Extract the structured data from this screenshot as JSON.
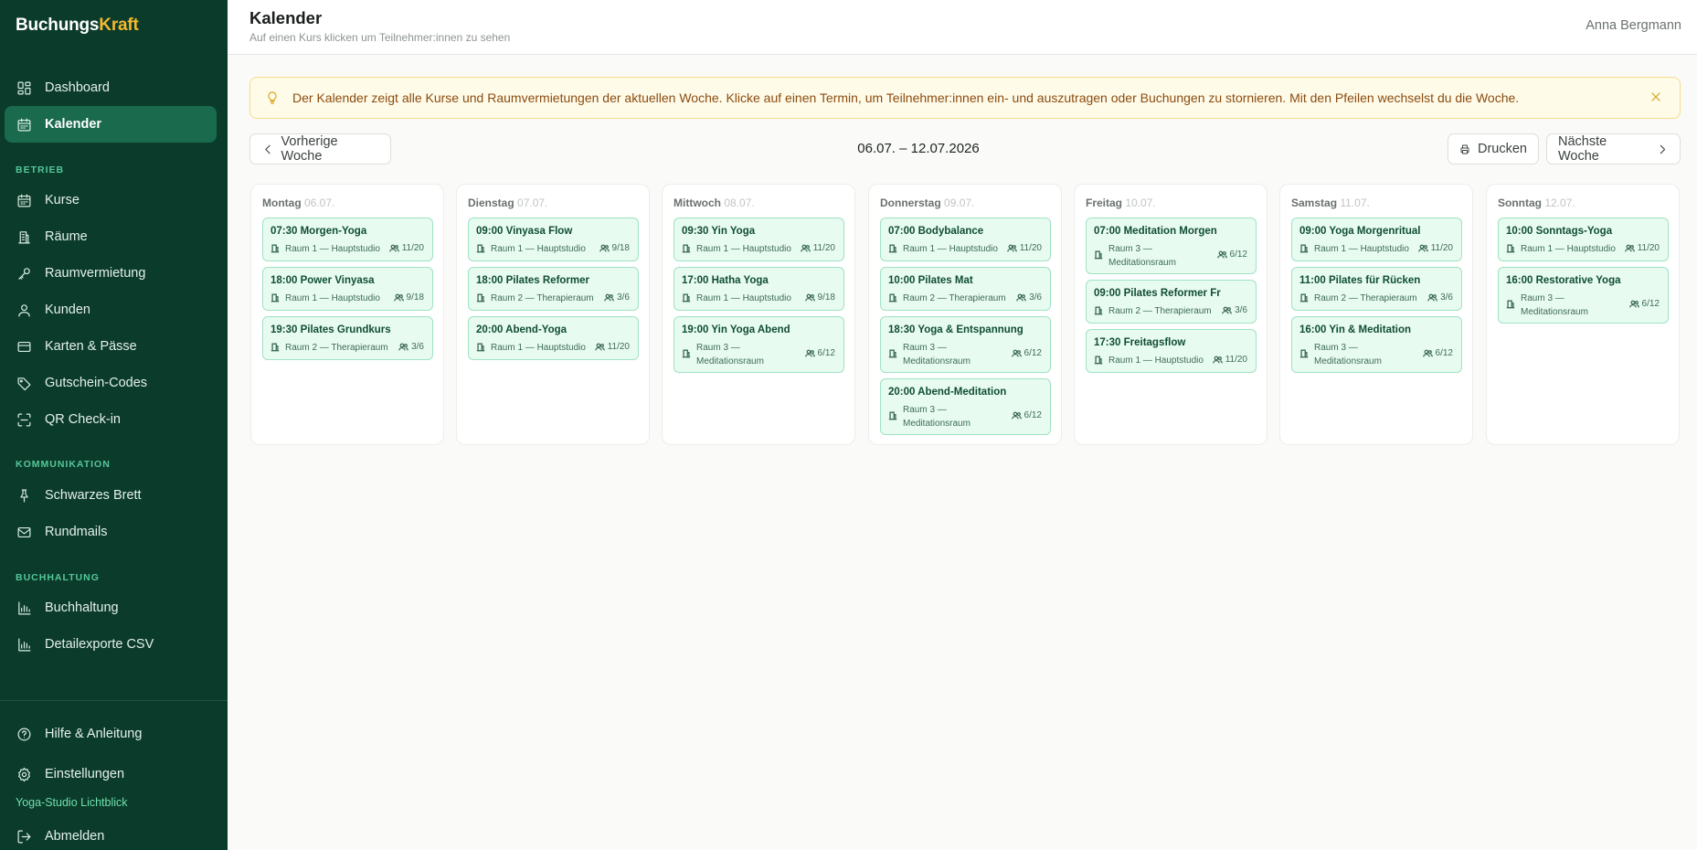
{
  "app": {
    "logo_main": "Buchungs",
    "logo_accent": "Kraft"
  },
  "sidebar": {
    "main_items": [
      {
        "label": "Dashboard",
        "icon": "dashboard-icon"
      },
      {
        "label": "Kalender",
        "icon": "calendar-icon",
        "active": true
      }
    ],
    "sections": [
      {
        "label": "BETRIEB",
        "items": [
          {
            "label": "Kurse",
            "icon": "calendar-icon"
          },
          {
            "label": "Räume",
            "icon": "building-icon"
          },
          {
            "label": "Raumvermietung",
            "icon": "key-icon"
          },
          {
            "label": "Kunden",
            "icon": "user-icon"
          },
          {
            "label": "Karten & Pässe",
            "icon": "card-icon"
          },
          {
            "label": "Gutschein-Codes",
            "icon": "tag-icon"
          },
          {
            "label": "QR Check-in",
            "icon": "qr-scan-icon"
          }
        ]
      },
      {
        "label": "KOMMUNIKATION",
        "items": [
          {
            "label": "Schwarzes Brett",
            "icon": "pin-icon"
          },
          {
            "label": "Rundmails",
            "icon": "mail-icon"
          }
        ]
      },
      {
        "label": "BUCHHALTUNG",
        "items": [
          {
            "label": "Buchhaltung",
            "icon": "bar-chart-icon"
          },
          {
            "label": "Detailexporte CSV",
            "icon": "bar-chart-icon"
          }
        ]
      }
    ],
    "help": "Hilfe & Anleitung",
    "settings": "Einstellungen",
    "studio": "Yoga-Studio Lichtblick",
    "logout": "Abmelden"
  },
  "header": {
    "title": "Kalender",
    "subtitle": "Auf einen Kurs klicken um Teilnehmer:innen zu sehen",
    "user": "Anna Bergmann"
  },
  "banner": {
    "text": "Der Kalender zeigt alle Kurse und Raumvermietungen der aktuellen Woche. Klicke auf einen Termin, um Teilnehmer:innen ein- und auszutragen oder Buchungen zu stornieren. Mit den Pfeilen wechselst du die Woche."
  },
  "week": {
    "prev_label": "Vorherige Woche",
    "range": "06.07. – 12.07.2026",
    "print_label": "Drucken",
    "next_label": "Nächste Woche"
  },
  "days": [
    {
      "name": "Montag",
      "date": "06.07.",
      "events": [
        {
          "title": "07:30 Morgen-Yoga",
          "room": "Raum 1 — Hauptstudio",
          "count": "11/20"
        },
        {
          "title": "18:00 Power Vinyasa",
          "room": "Raum 1 — Hauptstudio",
          "count": "9/18"
        },
        {
          "title": "19:30 Pilates Grundkurs",
          "room": "Raum 2 — Therapieraum",
          "count": "3/6"
        }
      ]
    },
    {
      "name": "Dienstag",
      "date": "07.07.",
      "events": [
        {
          "title": "09:00 Vinyasa Flow",
          "room": "Raum 1 — Hauptstudio",
          "count": "9/18"
        },
        {
          "title": "18:00 Pilates Reformer",
          "room": "Raum 2 — Therapieraum",
          "count": "3/6"
        },
        {
          "title": "20:00 Abend-Yoga",
          "room": "Raum 1 — Hauptstudio",
          "count": "11/20"
        }
      ]
    },
    {
      "name": "Mittwoch",
      "date": "08.07.",
      "events": [
        {
          "title": "09:30 Yin Yoga",
          "room": "Raum 1 — Hauptstudio",
          "count": "11/20"
        },
        {
          "title": "17:00 Hatha Yoga",
          "room": "Raum 1 — Hauptstudio",
          "count": "9/18"
        },
        {
          "title": "19:00 Yin Yoga Abend",
          "room_lines": [
            "Raum 3 —",
            "Meditationsraum"
          ],
          "count": "6/12"
        }
      ]
    },
    {
      "name": "Donnerstag",
      "date": "09.07.",
      "events": [
        {
          "title": "07:00 Bodybalance",
          "room": "Raum 1 — Hauptstudio",
          "count": "11/20"
        },
        {
          "title": "10:00 Pilates Mat",
          "room": "Raum 2 — Therapieraum",
          "count": "3/6"
        },
        {
          "title": "18:30 Yoga & Entspannung",
          "room_lines": [
            "Raum 3 —",
            "Meditationsraum"
          ],
          "count": "6/12"
        },
        {
          "title": "20:00 Abend-Meditation",
          "room_lines": [
            "Raum 3 —",
            "Meditationsraum"
          ],
          "count": "6/12"
        }
      ]
    },
    {
      "name": "Freitag",
      "date": "10.07.",
      "events": [
        {
          "title": "07:00 Meditation Morgen",
          "room_lines": [
            "Raum 3 —",
            "Meditationsraum"
          ],
          "count": "6/12"
        },
        {
          "title": "09:00 Pilates Reformer Fr",
          "room": "Raum 2 — Therapieraum",
          "count": "3/6"
        },
        {
          "title": "17:30 Freitagsflow",
          "room": "Raum 1 — Hauptstudio",
          "count": "11/20"
        }
      ]
    },
    {
      "name": "Samstag",
      "date": "11.07.",
      "events": [
        {
          "title": "09:00 Yoga Morgenritual",
          "room": "Raum 1 — Hauptstudio",
          "count": "11/20"
        },
        {
          "title": "11:00 Pilates für Rücken",
          "room": "Raum 2 — Therapieraum",
          "count": "3/6"
        },
        {
          "title": "16:00 Yin & Meditation",
          "room_lines": [
            "Raum 3 —",
            "Meditationsraum"
          ],
          "count": "6/12"
        }
      ]
    },
    {
      "name": "Sonntag",
      "date": "12.07.",
      "events": [
        {
          "title": "10:00 Sonntags-Yoga",
          "room": "Raum 1 — Hauptstudio",
          "count": "11/20"
        },
        {
          "title": "16:00 Restorative Yoga",
          "room_lines": [
            "Raum 3 —",
            "Meditationsraum"
          ],
          "count": "6/12"
        }
      ]
    }
  ],
  "colors": {
    "sidebar_bg": "#0b3b2b",
    "sidebar_active": "#1a6a4e",
    "logo_accent": "#f5b82e",
    "section_label": "#55c79a",
    "event_bg": "#e8fbf1",
    "event_border": "#9fe3c2",
    "banner_bg": "#fffbe9",
    "banner_text": "#8a4c10"
  }
}
